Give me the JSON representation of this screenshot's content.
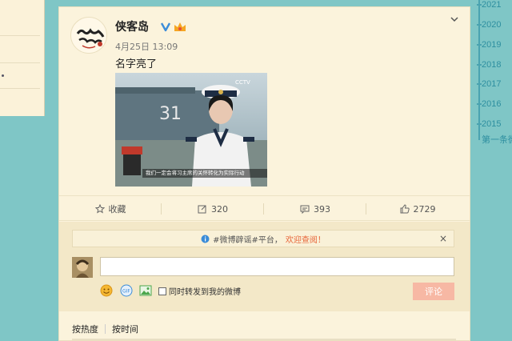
{
  "post": {
    "username": "侠客岛",
    "timestamp": "4月25日 13:09",
    "text": "名字亮了",
    "image_subtitle": "我们一定会将习主席的关怀转化为实际行动"
  },
  "actions": {
    "favorite_label": "收藏",
    "repost_count": "320",
    "comment_count": "393",
    "like_count": "2729"
  },
  "comment_box": {
    "notice_prefix": "#微博辟谣#平台，",
    "notice_link": "欢迎查阅！",
    "input_value": "",
    "repost_checkbox_label": "同时转发到我的微博",
    "submit_label": "评论"
  },
  "sort_tabs": [
    "按热度",
    "按时间"
  ],
  "timeline": {
    "years": [
      "2021",
      "2020",
      "2019",
      "2018",
      "2017",
      "2016",
      "2015"
    ],
    "first_label": "第一条微"
  },
  "colors": {
    "background": "#7fc6c6",
    "card": "#fbf3dc",
    "accent": "#2e8fa0",
    "submit": "#f7b8a4",
    "link": "#e8663a"
  }
}
